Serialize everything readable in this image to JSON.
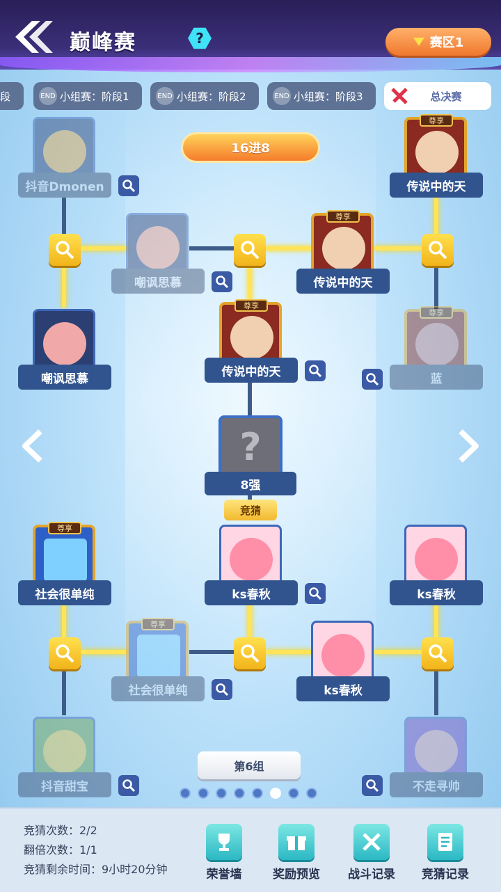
{
  "header": {
    "title": "巅峰赛",
    "help_icon": "?",
    "region_label": "赛区1"
  },
  "tabs": [
    {
      "label": "段",
      "end_badge": ""
    },
    {
      "label": "小组赛：阶段1",
      "end_badge": "END"
    },
    {
      "label": "小组赛：阶段2",
      "end_badge": "END"
    },
    {
      "label": "小组赛：阶段3",
      "end_badge": "END"
    },
    {
      "label": "总决赛",
      "end_badge": ""
    }
  ],
  "round_label": "16进8",
  "vip_tag": "尊享",
  "players": {
    "top_left": "抖音Dmonen",
    "top_right": "传说中的天",
    "mid_left_upper": "嘲讽思慕",
    "mid_right_upper": "传说中的天",
    "left_upper": "嘲讽思慕",
    "center_upper": "传说中的天",
    "right_upper": "蓝",
    "left_lower": "社会很单纯",
    "center_lower": "ks春秋",
    "right_lower": "ks春秋",
    "mid_left_lower": "社会很单纯",
    "mid_right_lower": "ks春秋",
    "bottom_left": "抖音甜宝",
    "bottom_right": "不走寻帅"
  },
  "unknown_label": "8强",
  "unknown_symbol": "?",
  "guess_tag": "竞猜",
  "group_label": "第6组",
  "pagination": {
    "total": 8,
    "current": 6
  },
  "footer": {
    "stats": {
      "guess_count": "竞猜次数：2/2",
      "double_count": "翻倍次数：1/1",
      "time_left": "竞猜剩余时间：9小时20分钟"
    },
    "buttons": {
      "honor": "荣誉墙",
      "reward": "奖励预览",
      "battle": "战斗记录",
      "guess_record": "竞猜记录"
    }
  },
  "colors": {
    "header_bg": "#2a1f57",
    "gold_line": "#ffe45a",
    "region_btn": "#f0782d",
    "dark_line": "#3e5c8a"
  }
}
